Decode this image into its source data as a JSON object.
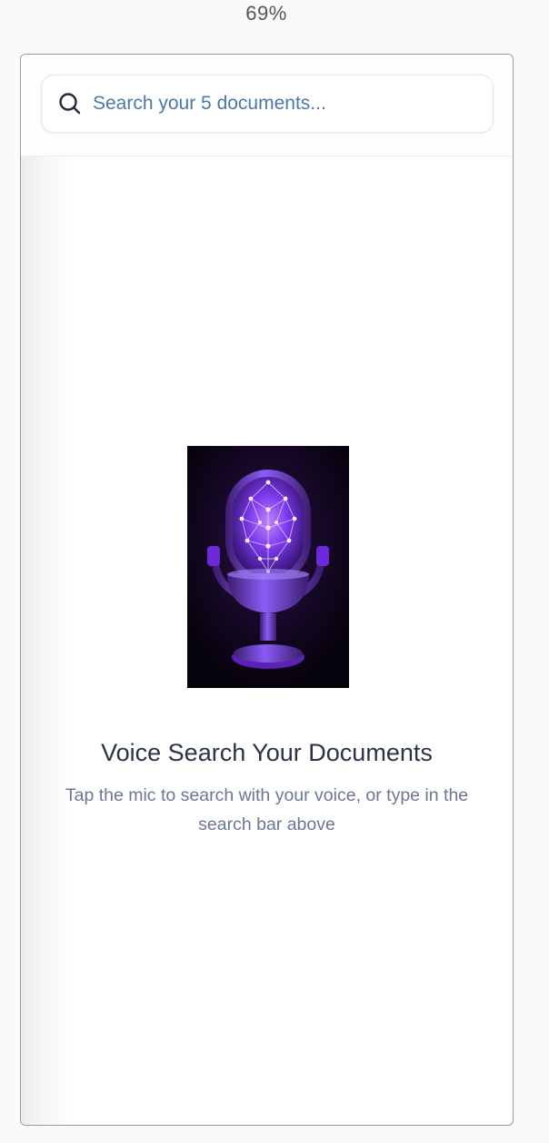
{
  "zoom": {
    "label": "69%"
  },
  "search": {
    "placeholder": "Search your 5 documents...",
    "value": ""
  },
  "empty_state": {
    "image": "neural-microphone-illustration",
    "title": "Voice Search Your Documents",
    "description": "Tap the mic to search with your voice, or type in the search bar above"
  },
  "colors": {
    "placeholder": "#4a78a8",
    "title": "#2b3446",
    "description": "#6b7794",
    "mic_glow": "#a855f7",
    "mic_body": "#6d28d9"
  }
}
